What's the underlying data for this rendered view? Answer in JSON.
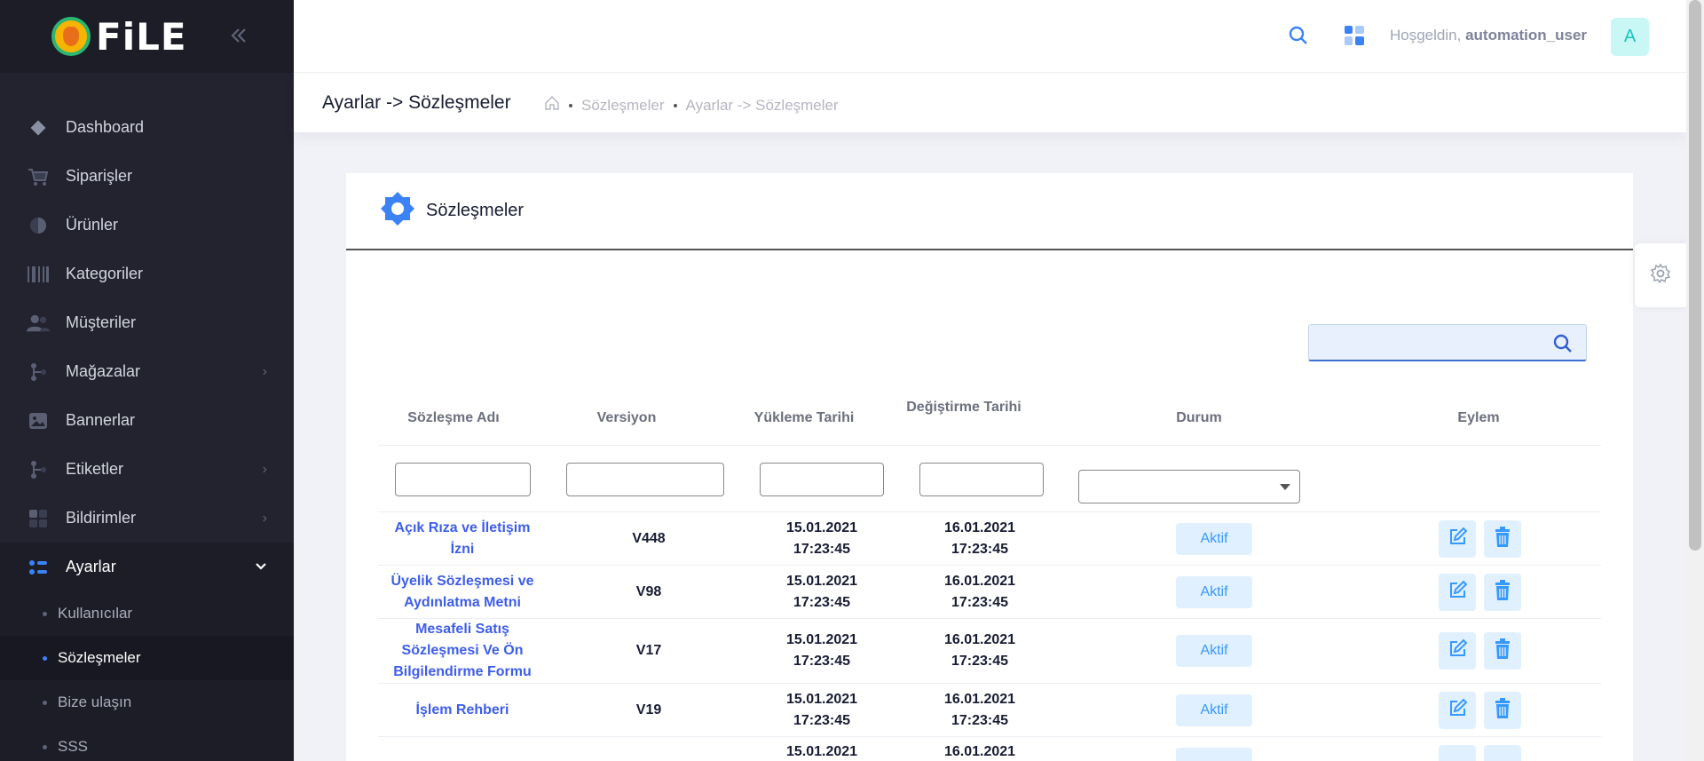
{
  "brand": {
    "name": "FiLE"
  },
  "sidebar": {
    "items": [
      {
        "label": "Dashboard",
        "icon": "diamond-icon"
      },
      {
        "label": "Siparişler",
        "icon": "cart-icon"
      },
      {
        "label": "Ürünler",
        "icon": "shield-icon"
      },
      {
        "label": "Kategoriler",
        "icon": "barcode-icon"
      },
      {
        "label": "Müşteriler",
        "icon": "users-icon"
      },
      {
        "label": "Mağazalar",
        "icon": "branch-icon"
      },
      {
        "label": "Bannerlar",
        "icon": "image-icon"
      },
      {
        "label": "Etiketler",
        "icon": "tag-icon"
      },
      {
        "label": "Bildirimler",
        "icon": "grid-icon"
      },
      {
        "label": "Ayarlar",
        "icon": "settings-dots-icon"
      }
    ],
    "sub_items": [
      {
        "label": "Kullanıcılar"
      },
      {
        "label": "Sözleşmeler"
      },
      {
        "label": "Bize ulaşın"
      },
      {
        "label": "SSS"
      }
    ]
  },
  "header": {
    "welcome_prefix": "Hoşgeldin,",
    "username": "automation_user",
    "avatar_letter": "A"
  },
  "subheader": {
    "title": "Ayarlar -> Sözleşmeler",
    "breadcrumb": [
      "Sözleşmeler",
      "Ayarlar -> Sözleşmeler"
    ]
  },
  "card": {
    "title": "Sözleşmeler"
  },
  "table": {
    "columns": [
      "Sözleşme Adı",
      "Versiyon",
      "Yükleme Tarihi",
      "Değiştirme Tarihi",
      "Durum",
      "Eylem"
    ],
    "rows": [
      {
        "name_l1": "Açık Rıza ve İletişim",
        "name_l2": "İzni",
        "name_l3": "",
        "version": "V448",
        "upload_date": "15.01.2021",
        "upload_time": "17:23:45",
        "modify_date": "16.01.2021",
        "modify_time": "17:23:45",
        "status": "Aktif"
      },
      {
        "name_l1": "Üyelik Sözleşmesi ve",
        "name_l2": "Aydınlatma Metni",
        "name_l3": "",
        "version": "V98",
        "upload_date": "15.01.2021",
        "upload_time": "17:23:45",
        "modify_date": "16.01.2021",
        "modify_time": "17:23:45",
        "status": "Aktif"
      },
      {
        "name_l1": "Mesafeli Satış",
        "name_l2": "Sözleşmesi Ve Ön",
        "name_l3": "Bilgilendirme Formu",
        "version": "V17",
        "upload_date": "15.01.2021",
        "upload_time": "17:23:45",
        "modify_date": "16.01.2021",
        "modify_time": "17:23:45",
        "status": "Aktif"
      },
      {
        "name_l1": "İşlem Rehberi",
        "name_l2": "",
        "name_l3": "",
        "version": "V19",
        "upload_date": "15.01.2021",
        "upload_time": "17:23:45",
        "modify_date": "16.01.2021",
        "modify_time": "17:23:45",
        "status": "Aktif"
      },
      {
        "name_l1": "",
        "name_l2": "",
        "name_l3": "",
        "version": "",
        "upload_date": "15.01.2021",
        "upload_time": "",
        "modify_date": "16.01.2021",
        "modify_time": "",
        "status": ""
      }
    ]
  },
  "colors": {
    "sidebar_bg": "#22232e",
    "accent": "#3b82f6",
    "link": "#3d5ee8",
    "badge_bg": "#e1f0ff",
    "badge_text": "#3699ff"
  }
}
